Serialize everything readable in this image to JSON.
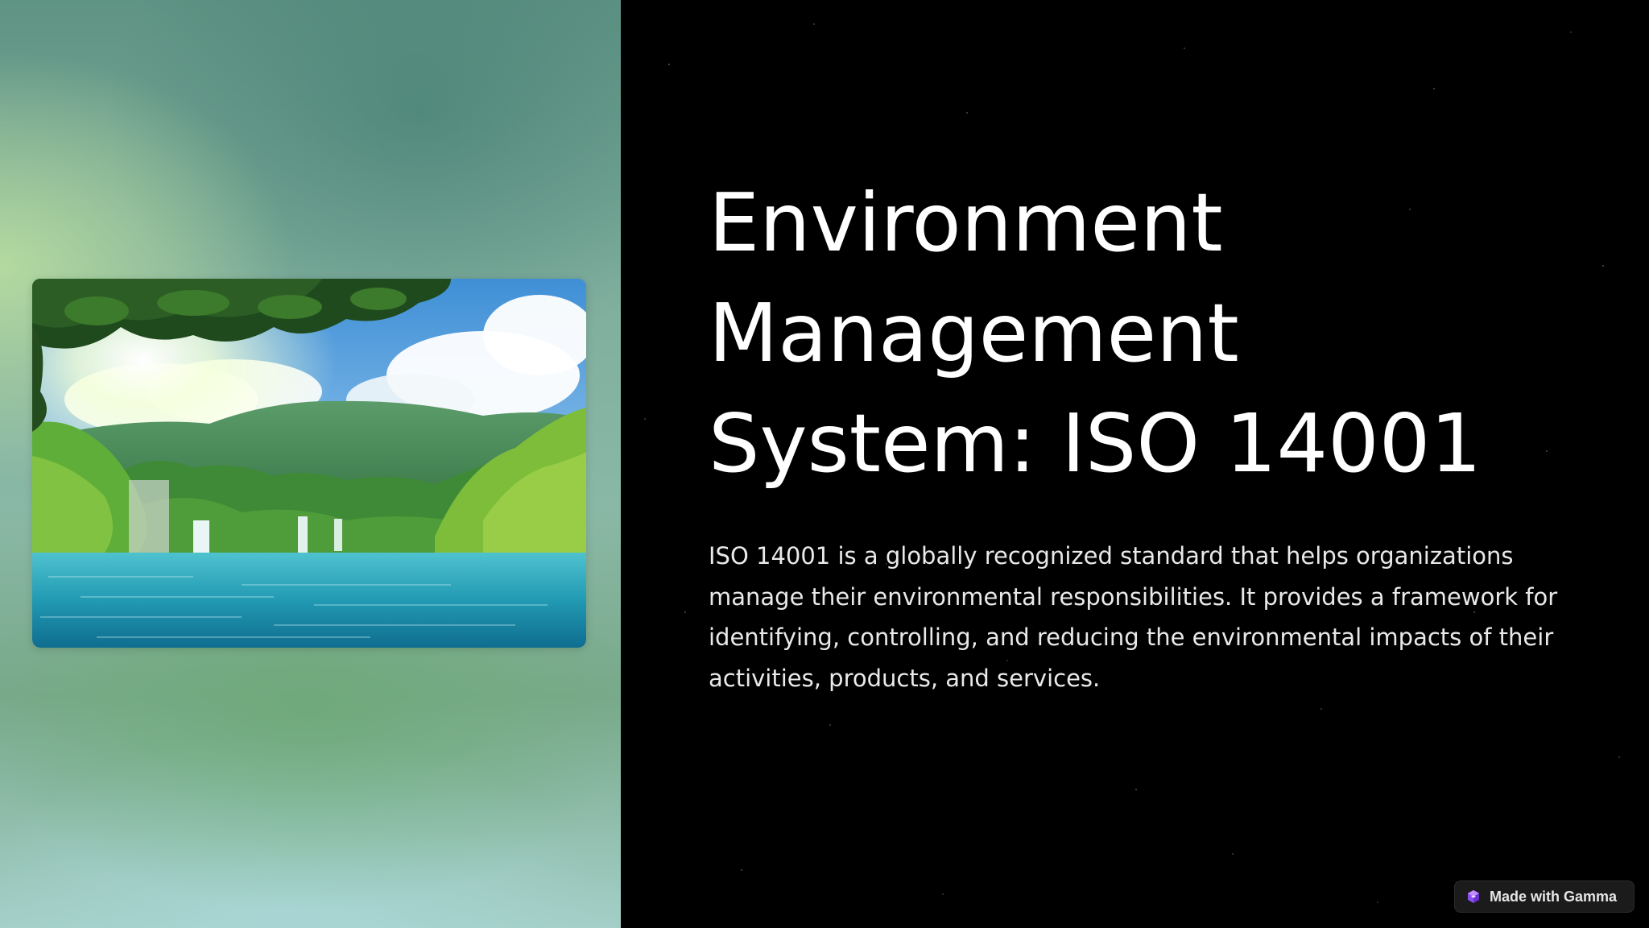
{
  "slide": {
    "title": "Environment Management System: ISO 14001",
    "body": "ISO 14001 is a globally recognized standard that helps organizations manage their environmental responsibilities. It provides a framework for identifying, controlling, and reducing the environmental impacts of their activities, products, and services."
  },
  "image": {
    "subject": "waterfall-lake-forest-photo"
  },
  "badge": {
    "label": "Made with Gamma",
    "icon": "gamma-logo-icon"
  },
  "colors": {
    "background_right": "#000000",
    "title_text": "#ffffff",
    "body_text": "#e9e9e9",
    "badge_bg": "#1b1b1b",
    "badge_icon": "#a05cf0"
  }
}
